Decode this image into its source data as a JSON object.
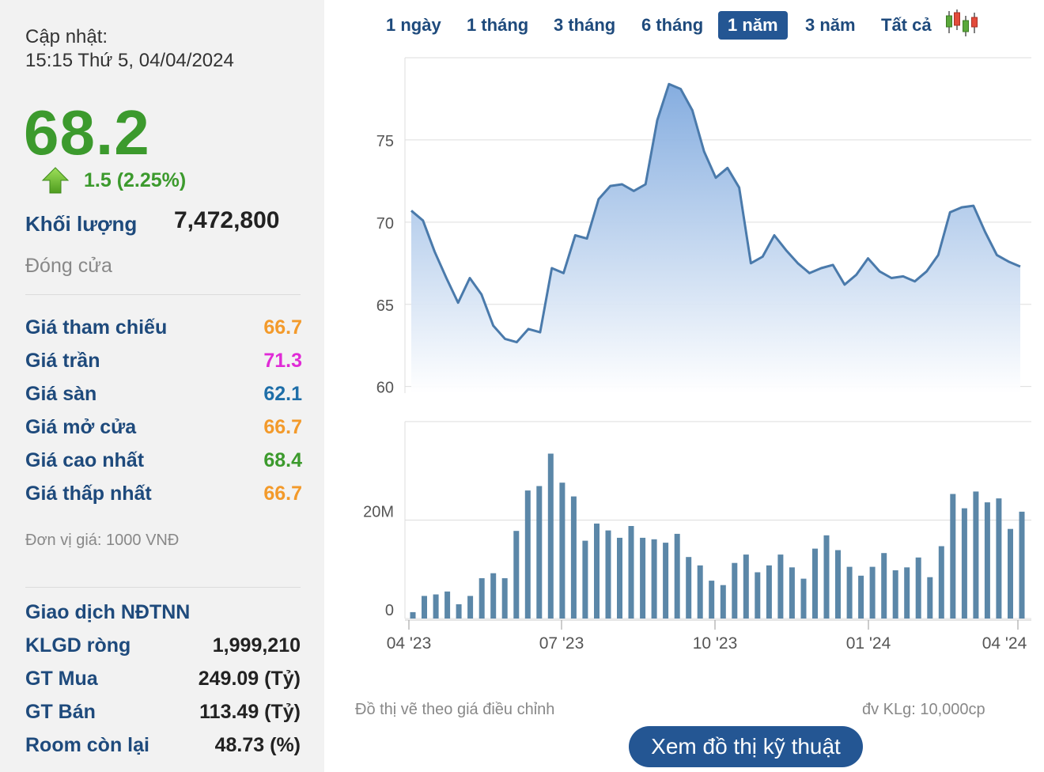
{
  "updated": {
    "label": "Cập nhật:",
    "time": "15:15 Thứ 5, 04/04/2024"
  },
  "price": {
    "value": "68.2",
    "change": "1.5 (2.25%)",
    "direction": "up",
    "color": "#3c9a2d"
  },
  "volume": {
    "label": "Khối lượng",
    "value": "7,472,800"
  },
  "status": "Đóng cửa",
  "stats": [
    {
      "label": "Giá tham chiếu",
      "value": "66.7",
      "color": "#f39a2b"
    },
    {
      "label": "Giá trần",
      "value": "71.3",
      "color": "#e02bd6"
    },
    {
      "label": "Giá sàn",
      "value": "62.1",
      "color": "#1e6ea8"
    },
    {
      "label": "Giá mở cửa",
      "value": "66.7",
      "color": "#f39a2b"
    },
    {
      "label": "Giá cao nhất",
      "value": "68.4",
      "color": "#3c9a2d"
    },
    {
      "label": "Giá thấp nhất",
      "value": "66.7",
      "color": "#f39a2b"
    }
  ],
  "unit": "Đơn vị giá: 1000 VNĐ",
  "foreign": {
    "title": "Giao dịch NĐTNN",
    "rows": [
      {
        "label": "KLGD ròng",
        "value": "1,999,210"
      },
      {
        "label": "GT Mua",
        "value": "249.09 (Tỷ)"
      },
      {
        "label": "GT Bán",
        "value": "113.49 (Tỷ)"
      },
      {
        "label": "Room còn lại",
        "value": "48.73 (%)"
      }
    ]
  },
  "tabs": [
    {
      "label": "1 ngày",
      "active": false
    },
    {
      "label": "1 tháng",
      "active": false
    },
    {
      "label": "3 tháng",
      "active": false
    },
    {
      "label": "6 tháng",
      "active": false
    },
    {
      "label": "1 năm",
      "active": true
    },
    {
      "label": "3 năm",
      "active": false
    },
    {
      "label": "Tất cả",
      "active": false
    }
  ],
  "icons": {
    "arrow": "up-arrow-icon",
    "chart_toggle": "candlestick-icon"
  },
  "colors": {
    "line": "#4a7aab",
    "bar": "#5b87a8",
    "accent": "#245693",
    "up": "#3c9a2d"
  },
  "chart_data": {
    "type": "area",
    "price_panel": {
      "yticks": [
        60,
        65,
        70,
        75
      ],
      "ylim": [
        59.6,
        80
      ],
      "series": [
        70.7,
        70.1,
        68.2,
        66.6,
        65.1,
        66.6,
        65.6,
        63.7,
        62.9,
        62.7,
        63.5,
        63.3,
        67.2,
        66.9,
        69.2,
        69.0,
        71.4,
        72.2,
        72.3,
        71.9,
        72.3,
        76.2,
        78.4,
        78.1,
        76.8,
        74.3,
        72.7,
        73.3,
        72.1,
        67.5,
        67.9,
        69.2,
        68.3,
        67.5,
        66.9,
        67.2,
        67.4,
        66.2,
        66.8,
        67.8,
        67.0,
        66.6,
        66.7,
        66.4,
        67.0,
        68.0,
        70.6,
        70.9,
        71.0,
        69.4,
        68.0,
        67.6,
        67.3
      ]
    },
    "volume_panel": {
      "yticks": [
        {
          "value": 0,
          "label": "0"
        },
        {
          "value": 20,
          "label": "20M"
        }
      ],
      "ylim": [
        0,
        40
      ],
      "values": [
        1.3,
        4.6,
        4.9,
        5.5,
        2.9,
        4.6,
        8.2,
        9.2,
        8.2,
        17.8,
        26.0,
        26.9,
        33.5,
        27.6,
        24.8,
        15.8,
        19.3,
        17.9,
        16.4,
        18.8,
        16.4,
        16.1,
        15.4,
        17.2,
        12.5,
        10.8,
        7.7,
        6.8,
        11.3,
        13.0,
        9.4,
        10.8,
        13.0,
        10.4,
        8.1,
        14.2,
        16.9,
        13.9,
        10.5,
        8.7,
        10.5,
        13.3,
        9.8,
        10.4,
        12.4,
        8.4,
        14.7,
        25.3,
        22.4,
        25.8,
        23.6,
        24.4,
        18.2,
        21.7
      ]
    },
    "x_ticks": [
      "04 '23",
      "07 '23",
      "10 '23",
      "01 '24",
      "04 '24"
    ],
    "note_left": "Đồ thị vẽ theo giá điều chỉnh",
    "note_right": "đv KLg: 10,000cp"
  },
  "button": {
    "label": "Xem đồ thị kỹ thuật"
  }
}
